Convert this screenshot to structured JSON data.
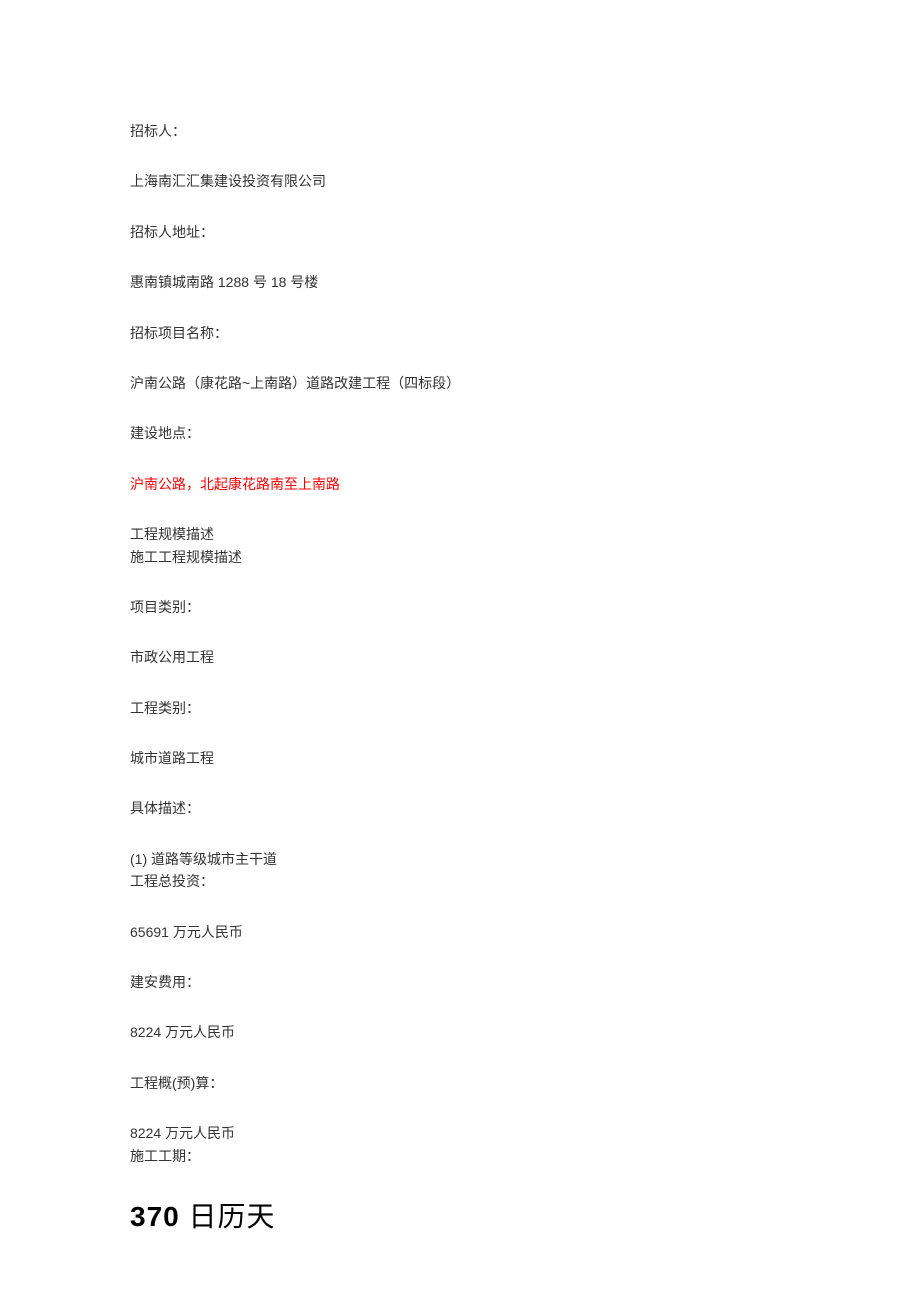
{
  "labels": {
    "tenderer": "招标人：",
    "tenderer_address": "招标人地址：",
    "project_name": "招标项目名称：",
    "construction_location": "建设地点：",
    "scale_desc1": "工程规模描述",
    "scale_desc2": "施工工程规模描述",
    "project_category": "项目类别：",
    "engineering_category": "工程类别：",
    "detail_desc": "具体描述：",
    "total_investment": "工程总投资：",
    "construction_cost": "建安费用：",
    "budget": "工程概(预)算：",
    "duration": "施工工期："
  },
  "values": {
    "tenderer": "上海南汇汇集建设投资有限公司",
    "tenderer_address": "惠南镇城南路 1288 号 18 号楼",
    "project_name": "沪南公路（康花路~上南路）道路改建工程（四标段）",
    "construction_location": "沪南公路，北起康花路南至上南路",
    "project_category": "市政公用工程",
    "engineering_category": "城市道路工程",
    "detail_desc": "(1) 道路等级城市主干道",
    "total_investment": "65691 万元人民币",
    "construction_cost": "8224 万元人民币",
    "budget": "8224 万元人民币",
    "duration_number": "370",
    "duration_unit": " 日历天"
  }
}
